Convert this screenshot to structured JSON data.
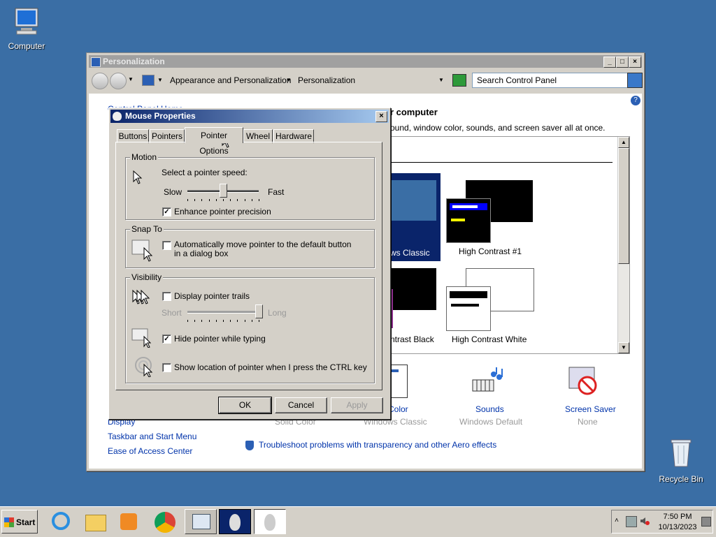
{
  "desktop": {
    "computer_label": "Computer",
    "recycle_label": "Recycle Bin"
  },
  "window": {
    "title": "Personalization",
    "breadcrumb": [
      "Appearance and Personalization",
      "Personalization"
    ],
    "search_placeholder": "Search Control Panel",
    "left_links": {
      "home": "Control Panel Home",
      "display": "Display",
      "taskbar": "Taskbar and Start Menu",
      "ease": "Ease of Access Center"
    },
    "heading_partial": "ur computer",
    "subheading_partial": "ound, window color, sounds, and screen saver all at once.",
    "themes": [
      {
        "label_partial": "ws Classic"
      },
      {
        "label": "High Contrast #1"
      },
      {
        "label_partial": "ntrast Black"
      },
      {
        "label": "High Contrast White"
      }
    ],
    "bottom_items": [
      {
        "title_partial": "w Color",
        "sub": "Windows Classic",
        "sub_left": "Solid Color"
      },
      {
        "title": "Sounds",
        "sub": "Windows Default"
      },
      {
        "title": "Screen Saver",
        "sub": "None"
      }
    ],
    "troubleshoot": "Troubleshoot problems with transparency and other Aero effects"
  },
  "dialog": {
    "title": "Mouse Properties",
    "tabs": [
      "Buttons",
      "Pointers",
      "Pointer Options",
      "Wheel",
      "Hardware"
    ],
    "active_tab": "Pointer Options",
    "motion": {
      "group": "Motion",
      "prompt": "Select a pointer speed:",
      "slow": "Slow",
      "fast": "Fast",
      "speed_fraction": 0.5,
      "enhance_label": "Enhance pointer precision",
      "enhance_checked": true
    },
    "snap": {
      "group": "Snap To",
      "label": "Automatically move pointer to the default button in a dialog box",
      "checked": false
    },
    "visibility": {
      "group": "Visibility",
      "trails_label": "Display pointer trails",
      "trails_checked": false,
      "short": "Short",
      "long": "Long",
      "trail_fraction": 1.0,
      "hide_label": "Hide pointer while typing",
      "hide_checked": true,
      "ctrl_label": "Show location of pointer when I press the CTRL key",
      "ctrl_checked": false
    },
    "buttons": {
      "ok": "OK",
      "cancel": "Cancel",
      "apply": "Apply"
    }
  },
  "taskbar": {
    "start": "Start",
    "time": "7:50 PM",
    "date": "10/13/2023"
  },
  "colors": {
    "desktop": "#3a6ea5",
    "title_active": "#0a246a",
    "link": "#0033aa"
  }
}
